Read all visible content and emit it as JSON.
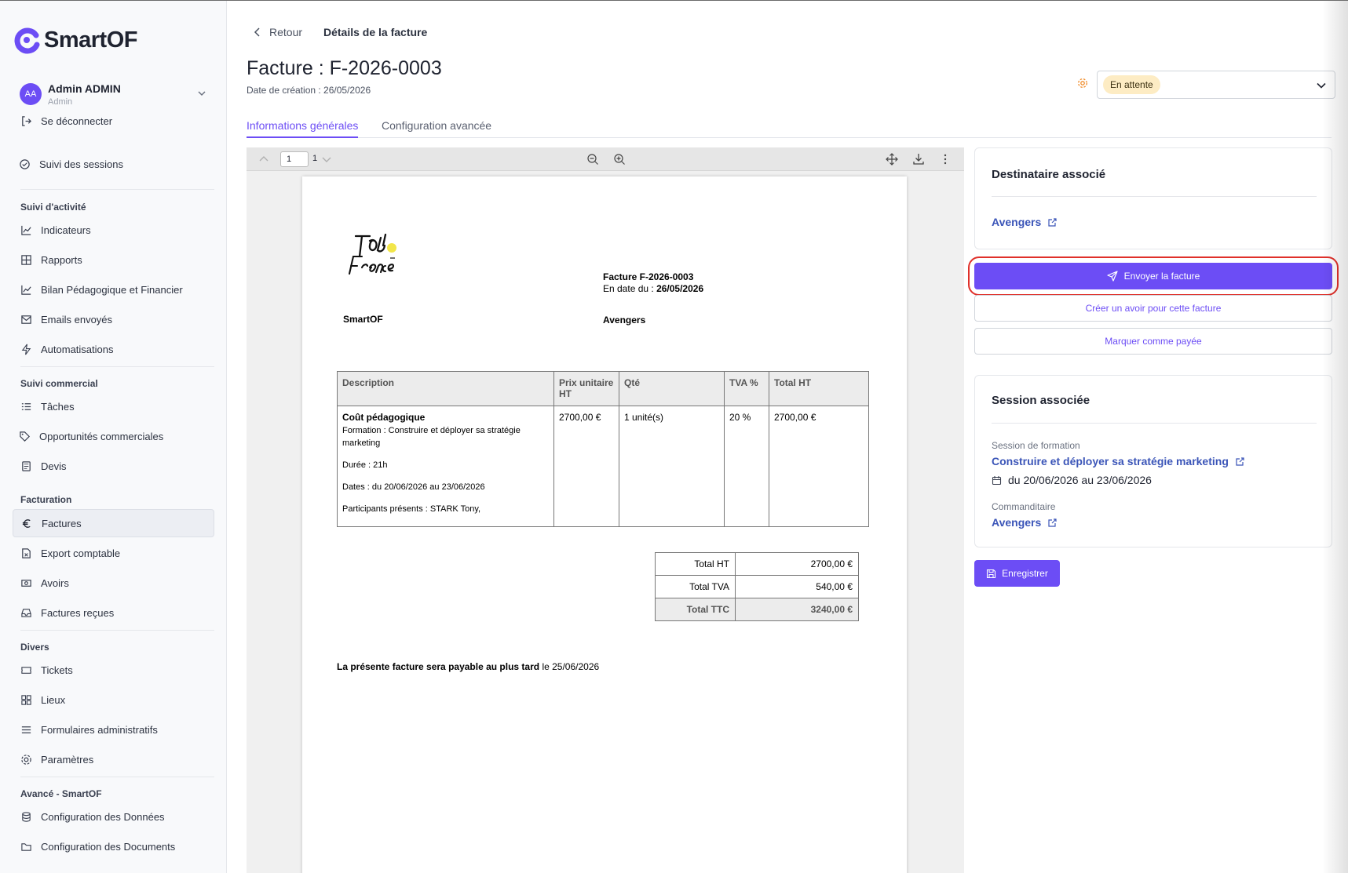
{
  "app": {
    "name": "SmartOF"
  },
  "user": {
    "initials": "AA",
    "name": "Admin ADMIN",
    "role": "Admin",
    "logout": "Se déconnecter"
  },
  "sidebar": {
    "sessions": "Suivi des sessions",
    "sections": {
      "activite": "Suivi d'activité",
      "commercial": "Suivi commercial",
      "facturation": "Facturation",
      "divers": "Divers",
      "avance": "Avancé - SmartOF"
    },
    "items": {
      "indicateurs": "Indicateurs",
      "rapports": "Rapports",
      "bilan": "Bilan Pédagogique et Financier",
      "emails": "Emails envoyés",
      "automatisations": "Automatisations",
      "taches": "Tâches",
      "opportunites": "Opportunités commerciales",
      "devis": "Devis",
      "factures": "Factures",
      "export": "Export comptable",
      "avoirs": "Avoirs",
      "factures_recues": "Factures reçues",
      "tickets": "Tickets",
      "lieux": "Lieux",
      "formulaires": "Formulaires administratifs",
      "parametres": "Paramètres",
      "config_donnees": "Configuration des Données",
      "config_documents": "Configuration des Documents"
    }
  },
  "header": {
    "back": "Retour",
    "breadcrumb": "Détails de la facture",
    "title": "Facture : F-2026-0003",
    "created": "Date de création : 26/05/2026",
    "status": "En attente"
  },
  "tabs": {
    "general": "Informations générales",
    "advanced": "Configuration avancée"
  },
  "viewer": {
    "page": "1",
    "total": "1"
  },
  "invoice": {
    "number": "Facture F-2026-0003",
    "date_label": "En date du : ",
    "date": "26/05/2026",
    "seller": "SmartOF",
    "buyer": "Avengers",
    "headers": {
      "description": "Description",
      "unit_price": "Prix unitaire HT",
      "qty": "Qté",
      "vat": "TVA %",
      "total": "Total HT"
    },
    "line": {
      "title": "Coût pédagogique",
      "formation": "Formation : Construire et déployer sa stratégie marketing",
      "duree": "Durée : 21h",
      "dates": "Dates : du 20/06/2026 au 23/06/2026",
      "participants": "Participants présents :  STARK Tony,",
      "unit_price": "2700,00 €",
      "qty": "1 unité(s)",
      "vat": "20 %",
      "total": "2700,00 €"
    },
    "totals": {
      "ht_label": "Total HT",
      "ht": "2700,00 €",
      "tva_label": "Total TVA",
      "tva": "540,00 €",
      "ttc_label": "Total TTC",
      "ttc": "3240,00 €"
    },
    "payable_bold": "La présente facture sera payable au plus tard",
    "payable_rest": " le 25/06/2026"
  },
  "right": {
    "recipient_title": "Destinataire associé",
    "recipient": "Avengers",
    "send": "Envoyer la facture",
    "credit": "Créer un avoir pour cette facture",
    "paid": "Marquer comme payée",
    "session_title": "Session associée",
    "session_label": "Session de formation",
    "session_name": "Construire et déployer sa stratégie marketing",
    "session_dates": "du 20/06/2026 au 23/06/2026",
    "sponsor_label": "Commanditaire",
    "sponsor": "Avengers",
    "save": "Enregistrer"
  },
  "colors": {
    "accent": "#6c4df5",
    "link": "#3b55b8",
    "status_bg": "#fdecc4",
    "highlight_ring": "#e0302a"
  }
}
